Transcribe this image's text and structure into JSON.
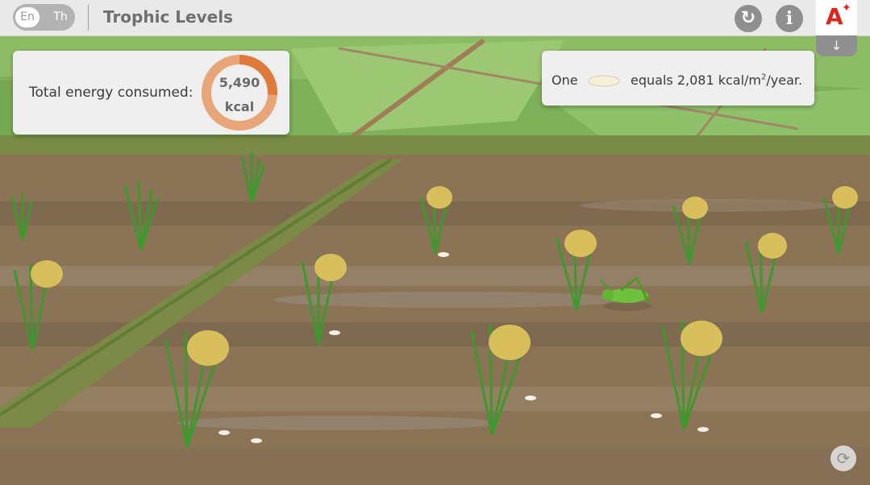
{
  "header": {
    "lang_en": "En",
    "lang_th": "Th",
    "title": "Trophic Levels",
    "reset_icon": "↻",
    "info_icon": "i",
    "logo_text": "A",
    "collapse_icon": "↓"
  },
  "energy": {
    "label": "Total energy consumed:",
    "value": "5,490",
    "unit": "kcal",
    "fraction": 0.26,
    "colors": {
      "filled": "#e07a3a",
      "track": "#e8a678"
    }
  },
  "legend": {
    "prefix": "One",
    "value_text": "equals 2,081 kcal/m",
    "superscript": "2",
    "suffix": "/year."
  },
  "scene": {
    "replay_icon": "⟳"
  }
}
